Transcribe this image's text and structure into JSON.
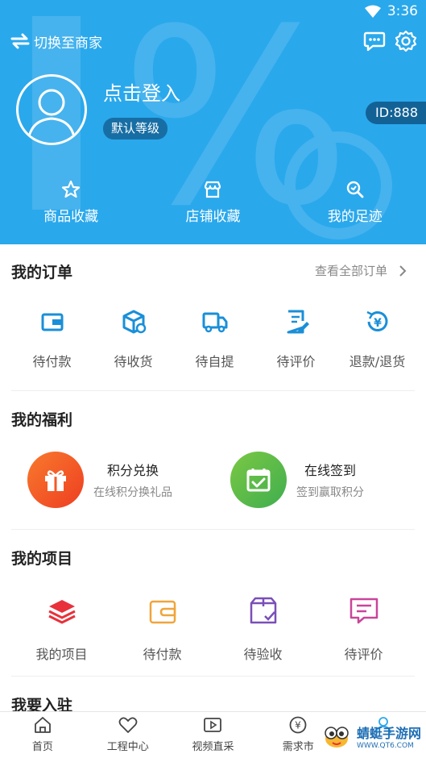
{
  "status_bar": {
    "time": "3:36"
  },
  "header": {
    "switch_label": "切换至商家",
    "login_text": "点击登入",
    "level_badge": "默认等级",
    "id_tag": "ID:888",
    "favorites": [
      {
        "label": "商品收藏",
        "icon": "star-icon"
      },
      {
        "label": "店铺收藏",
        "icon": "store-icon"
      },
      {
        "label": "我的足迹",
        "icon": "footprint-icon"
      }
    ]
  },
  "orders": {
    "title": "我的订单",
    "view_all": "查看全部订单",
    "items": [
      {
        "label": "待付款",
        "icon": "wallet-icon"
      },
      {
        "label": "待收货",
        "icon": "package-icon"
      },
      {
        "label": "待自提",
        "icon": "truck-icon"
      },
      {
        "label": "待评价",
        "icon": "edit-icon"
      },
      {
        "label": "退款/退货",
        "icon": "refund-icon"
      }
    ]
  },
  "benefits": {
    "title": "我的福利",
    "items": [
      {
        "title": "积分兑换",
        "subtitle": "在线积分换礼品",
        "icon": "gift-icon",
        "color": "#f25a24"
      },
      {
        "title": "在线签到",
        "subtitle": "签到赢取积分",
        "icon": "calendar-check-icon",
        "color": "#56b94a"
      }
    ]
  },
  "projects": {
    "title": "我的项目",
    "items": [
      {
        "label": "我的项目",
        "icon": "layers-icon"
      },
      {
        "label": "待付款",
        "icon": "wallet-icon"
      },
      {
        "label": "待验收",
        "icon": "box-check-icon"
      },
      {
        "label": "待评价",
        "icon": "comment-icon"
      }
    ]
  },
  "join": {
    "title": "我要入驻"
  },
  "bottom_nav": [
    {
      "label": "首页",
      "icon": "home-icon"
    },
    {
      "label": "工程中心",
      "icon": "heart-icon"
    },
    {
      "label": "视频直采",
      "icon": "video-icon"
    },
    {
      "label": "需求市",
      "icon": "yuan-icon"
    },
    {
      "label": "",
      "icon": "user-icon"
    }
  ],
  "watermark": {
    "title": "蜻蜓手游网",
    "url": "WWW.QT6.COM"
  },
  "colors": {
    "header": "#2aa8ec",
    "accent": "#1a8fd8",
    "red": "#e8313b",
    "orange": "#f0a53a",
    "purple": "#7a4fb8",
    "pink": "#c9459a"
  }
}
